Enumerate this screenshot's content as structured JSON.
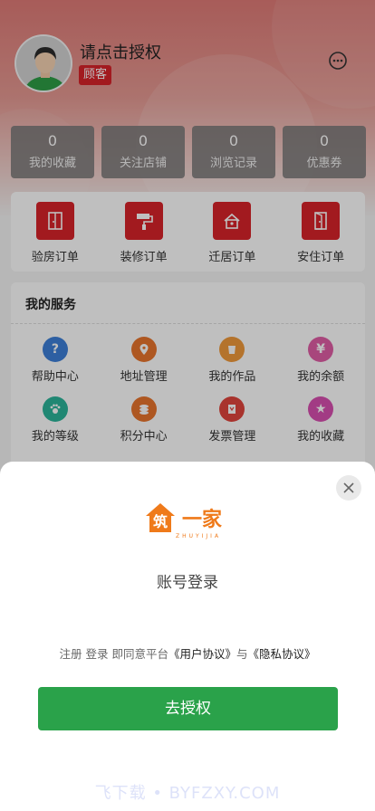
{
  "profile": {
    "username": "请点击授权",
    "role": "顾客"
  },
  "stats": [
    {
      "num": "0",
      "label": "我的收藏"
    },
    {
      "num": "0",
      "label": "关注店铺"
    },
    {
      "num": "0",
      "label": "浏览记录"
    },
    {
      "num": "0",
      "label": "优惠券"
    }
  ],
  "orders": [
    {
      "label": "验房订单",
      "icon": "door-icon"
    },
    {
      "label": "装修订单",
      "icon": "paint-roller-icon"
    },
    {
      "label": "迁居订单",
      "icon": "house-icon"
    },
    {
      "label": "安住订单",
      "icon": "door-open-icon"
    }
  ],
  "services": {
    "title": "我的服务",
    "items": [
      {
        "label": "帮助中心",
        "icon": "help-icon",
        "color": "#3d7fd8"
      },
      {
        "label": "地址管理",
        "icon": "location-icon",
        "color": "#e8742c"
      },
      {
        "label": "我的作品",
        "icon": "cup-icon",
        "color": "#f09a3b"
      },
      {
        "label": "我的余额",
        "icon": "money-bag-icon",
        "color": "#e05ea6"
      },
      {
        "label": "我的等级",
        "icon": "paw-icon",
        "color": "#2bb59a"
      },
      {
        "label": "积分中心",
        "icon": "coins-icon",
        "color": "#e8742c"
      },
      {
        "label": "发票管理",
        "icon": "invoice-icon",
        "color": "#e0453c"
      },
      {
        "label": "我的收藏",
        "icon": "star-icon",
        "color": "#d94fb0"
      }
    ]
  },
  "sheet": {
    "logo_text": "筑一家",
    "logo_sub": "ZHUYIJIA",
    "title": "账号登录",
    "agree_prefix": "注册 登录 即同意平台",
    "user_agreement": "《用户协议》",
    "conj": "与",
    "privacy": "《隐私协议》",
    "button": "去授权",
    "watermark": "飞下载 • BYFZXY.COM"
  }
}
